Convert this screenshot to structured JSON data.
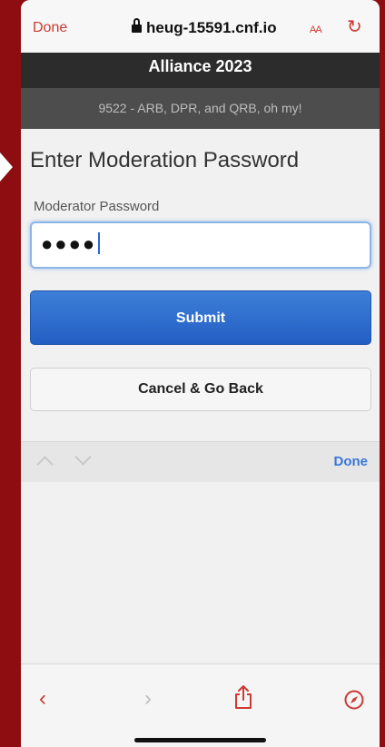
{
  "safari": {
    "done_label": "Done",
    "host": "heug-15591.cnf.io",
    "text_size_label": "AA",
    "reload_icon": "reload-icon"
  },
  "page": {
    "title": "Alliance 2023",
    "subtitle": "9522 - ARB, DPR, and QRB, oh my!",
    "heading": "Enter Moderation Password",
    "password_label": "Moderator Password",
    "password_value": "●●●●",
    "submit_label": "Submit",
    "cancel_label": "Cancel & Go Back"
  },
  "form_toolbar": {
    "done_label": "Done"
  },
  "colors": {
    "accent_red": "#cc3a33",
    "submit_blue": "#2f6fd0",
    "background_red": "#8e0d11",
    "title_bar": "#2c2c2c"
  }
}
